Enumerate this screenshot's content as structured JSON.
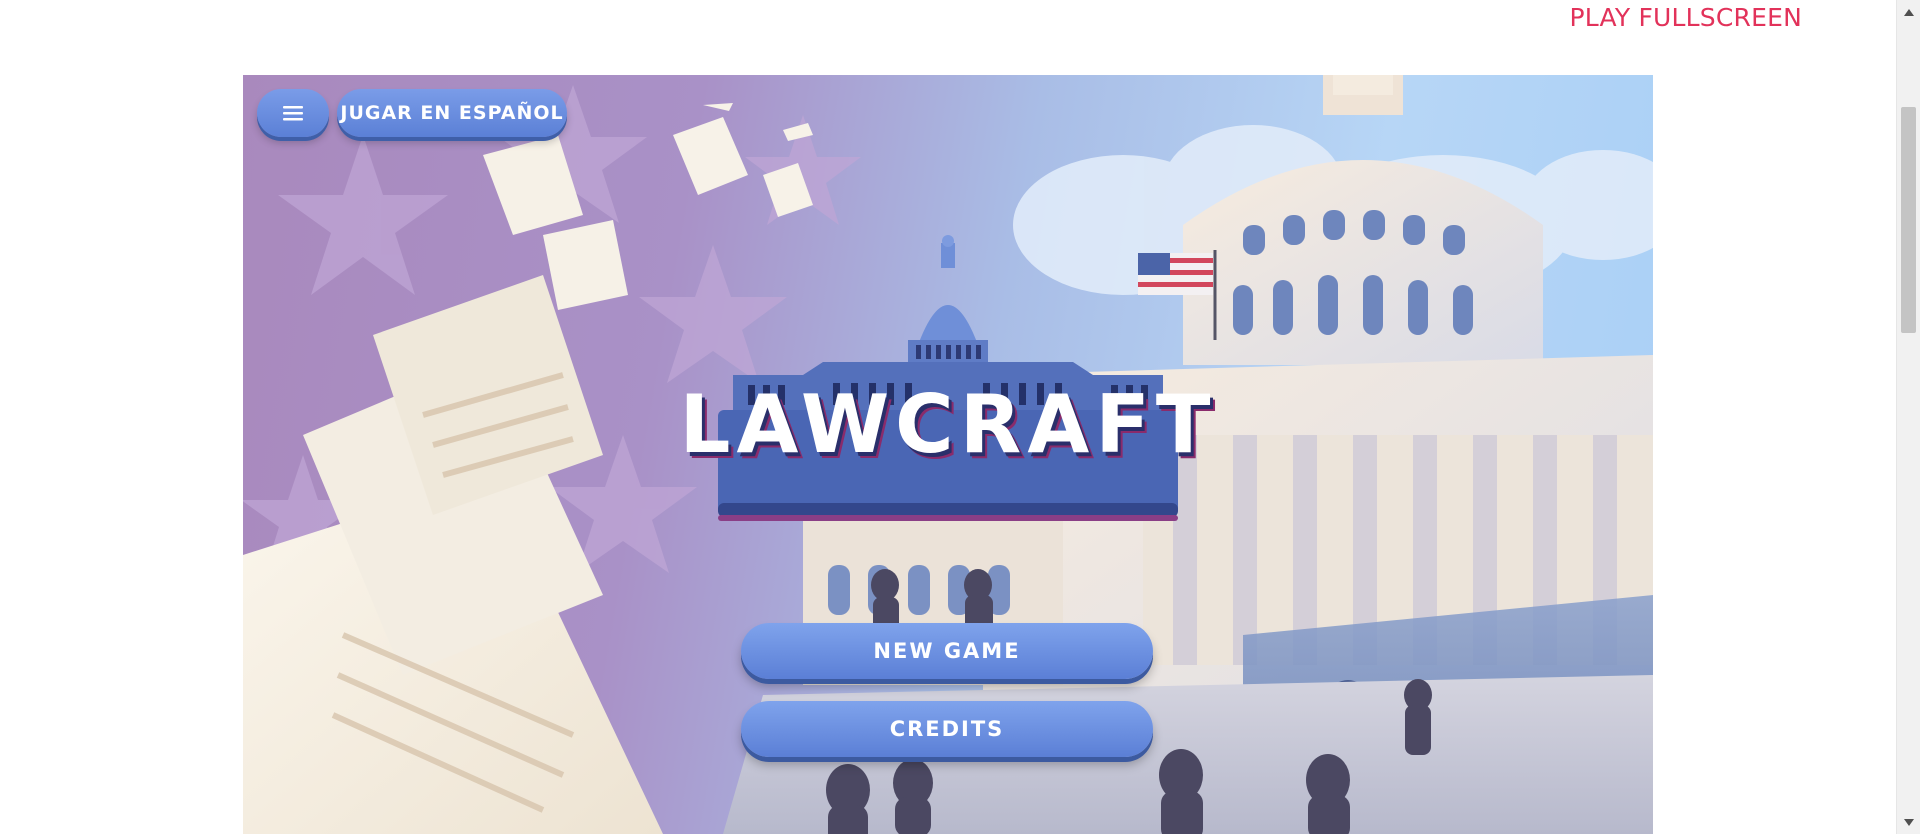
{
  "header": {
    "fullscreen_label": "PLAY FULLSCREEN"
  },
  "colors": {
    "accent_link": "#e2325a",
    "button_blue": "#6a8fe0",
    "title_shadow": "#2a2f6b"
  },
  "game": {
    "menu_icon": "hamburger-menu-icon",
    "language_button": "JUGAR EN ESPAÑOL",
    "logo_title": "LAWCRAFT",
    "buttons": {
      "new_game": "NEW GAME",
      "credits": "CREDITS"
    }
  },
  "scrollbar": {
    "up_icon": "scroll-up-arrow-icon",
    "down_icon": "scroll-down-arrow-icon"
  }
}
